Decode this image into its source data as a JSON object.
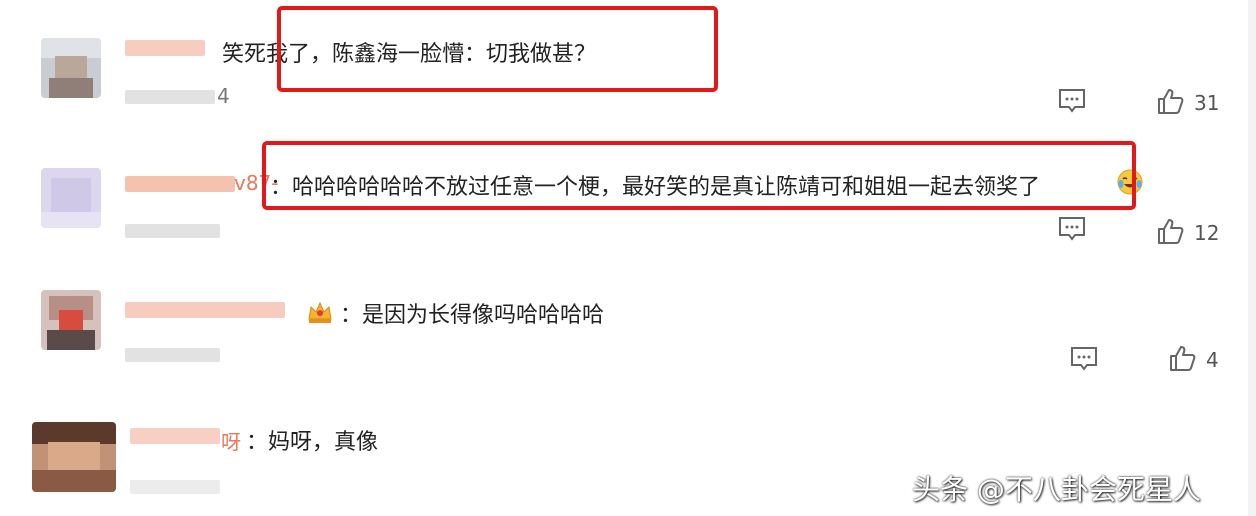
{
  "comments": [
    {
      "text": "笑死我了，陈鑫海一脸懵：切我做甚？",
      "meta_tail": "4",
      "likes": "31"
    },
    {
      "name_tail": "v87-",
      "text": "：哈哈哈哈哈哈不放过任意一个梗，最好笑的是真让陈靖可和姐姐一起去领奖了",
      "likes": "12"
    },
    {
      "text": "：是因为长得像吗哈哈哈哈",
      "likes": "4"
    },
    {
      "name_tail": "呀",
      "text": "：妈呀，真像"
    }
  ],
  "watermark": "头条 @不八卦会死星人",
  "icons": [
    "reply-icon",
    "like-icon",
    "laugh-cry-emoji",
    "crown-badge-icon"
  ],
  "colors": {
    "highlight_box": "#e31818",
    "name_color": "#e9775a"
  }
}
